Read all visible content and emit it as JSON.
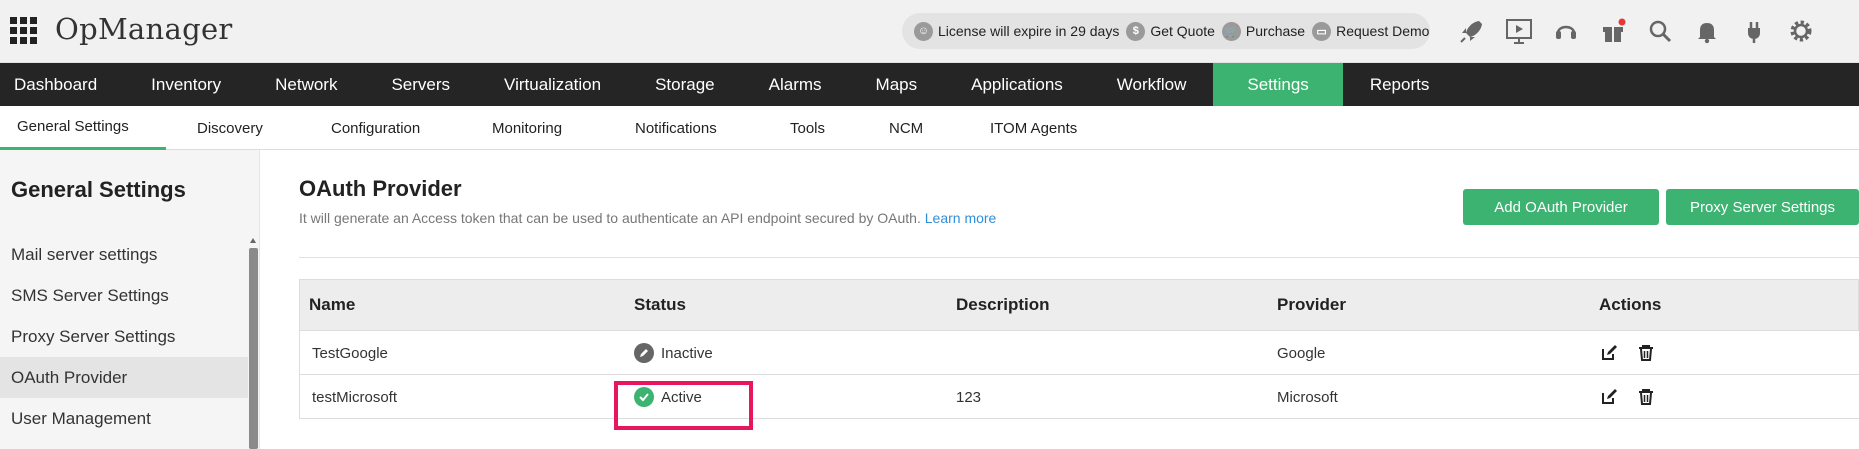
{
  "app": {
    "brand": "OpManager"
  },
  "topbar": {
    "license_text": "License will expire in 29 days",
    "get_quote": "Get Quote",
    "purchase": "Purchase",
    "request_demo": "Request Demo"
  },
  "mainnav": {
    "items": [
      {
        "label": "Dashboard"
      },
      {
        "label": "Inventory"
      },
      {
        "label": "Network"
      },
      {
        "label": "Servers"
      },
      {
        "label": "Virtualization"
      },
      {
        "label": "Storage"
      },
      {
        "label": "Alarms"
      },
      {
        "label": "Maps"
      },
      {
        "label": "Applications"
      },
      {
        "label": "Workflow"
      },
      {
        "label": "Settings"
      },
      {
        "label": "Reports"
      }
    ],
    "active": "Settings"
  },
  "subnav": {
    "items": [
      {
        "label": "General Settings"
      },
      {
        "label": "Discovery"
      },
      {
        "label": "Configuration"
      },
      {
        "label": "Monitoring"
      },
      {
        "label": "Notifications"
      },
      {
        "label": "Tools"
      },
      {
        "label": "NCM"
      },
      {
        "label": "ITOM Agents"
      }
    ],
    "active": "General Settings"
  },
  "sidebar": {
    "title": "General Settings",
    "items": [
      {
        "label": "Mail server settings"
      },
      {
        "label": "SMS Server Settings"
      },
      {
        "label": "Proxy Server Settings"
      },
      {
        "label": "OAuth Provider"
      },
      {
        "label": "User Management"
      }
    ],
    "active": "OAuth Provider"
  },
  "content": {
    "title": "OAuth Provider",
    "description": "It will generate an Access token that can be used to authenticate an API endpoint secured by OAuth.",
    "learn_more": "Learn more",
    "buttons": {
      "add_provider": "Add OAuth Provider",
      "proxy_settings": "Proxy Server Settings"
    }
  },
  "table": {
    "headers": {
      "name": "Name",
      "status": "Status",
      "description": "Description",
      "provider": "Provider",
      "actions": "Actions"
    },
    "rows": [
      {
        "name": "TestGoogle",
        "status": "Inactive",
        "description": "",
        "provider": "Google"
      },
      {
        "name": "testMicrosoft",
        "status": "Active",
        "description": "123",
        "provider": "Microsoft"
      }
    ]
  },
  "colors": {
    "accent": "#3cb371",
    "nav_bg": "#252525",
    "link": "#2f8fd8",
    "highlight": "#e8175d",
    "status_active": "#3cb371",
    "status_inactive": "#666666"
  },
  "icons": {
    "apps": "grid-icon",
    "license": "license-icon",
    "quote": "dollar-icon",
    "purchase": "cart-icon",
    "demo": "demo-icon",
    "top_right": [
      "rocket-icon",
      "presentation-icon",
      "headset-icon",
      "gift-icon",
      "search-icon",
      "bell-icon",
      "plug-icon",
      "gear-icon"
    ],
    "row_actions": [
      "edit-icon",
      "trash-icon"
    ]
  }
}
